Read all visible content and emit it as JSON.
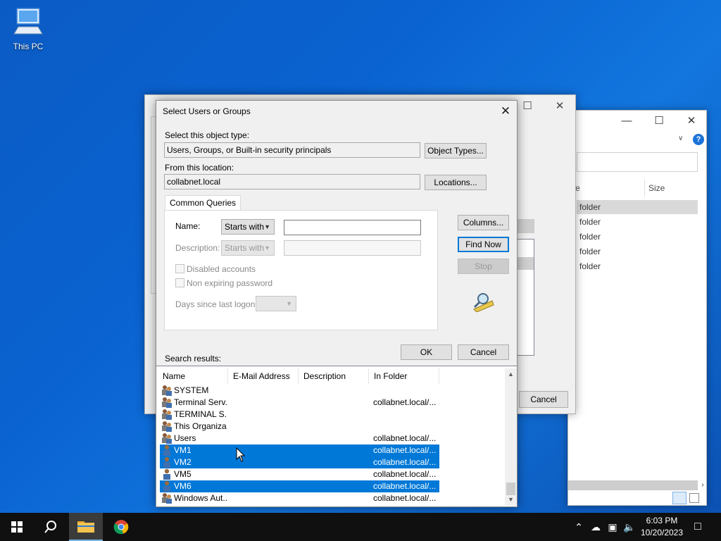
{
  "desktop": {
    "icons": [
      {
        "label": "This PC",
        "icon": "this-pc-icon"
      }
    ]
  },
  "explorer": {
    "columns": [
      "e",
      "Size"
    ],
    "rows": [
      "folder",
      "folder",
      "folder",
      "folder",
      "folder"
    ]
  },
  "perm_dialog": {
    "cancel_label": "Cancel"
  },
  "dialog": {
    "title": "Select Users or Groups",
    "object_type_label": "Select this object type:",
    "object_type_value": "Users, Groups, or Built-in security principals",
    "object_types_button": "Object Types...",
    "location_label": "From this location:",
    "location_value": "collabnet.local",
    "locations_button": "Locations...",
    "tab_label": "Common Queries",
    "name_label": "Name:",
    "name_mode": "Starts with",
    "description_label": "Description:",
    "description_mode": "Starts with",
    "disabled_accounts_label": "Disabled accounts",
    "non_expiring_label": "Non expiring password",
    "days_label": "Days since last logon:",
    "columns_button": "Columns...",
    "find_now_button": "Find Now",
    "stop_button": "Stop",
    "ok_button": "OK",
    "cancel_button": "Cancel",
    "search_results_label": "Search results:"
  },
  "results": {
    "columns": [
      "Name",
      "E-Mail Address",
      "Description",
      "In Folder"
    ],
    "rows": [
      {
        "name": "SYSTEM",
        "folder": "",
        "icon": "group-icon",
        "selected": false
      },
      {
        "name": "Terminal Serv...",
        "folder": "collabnet.local/...",
        "icon": "group-icon",
        "selected": false
      },
      {
        "name": "TERMINAL S...",
        "folder": "",
        "icon": "group-icon",
        "selected": false
      },
      {
        "name": "This Organiza...",
        "folder": "",
        "icon": "group-icon",
        "selected": false
      },
      {
        "name": "Users",
        "folder": "collabnet.local/...",
        "icon": "group-icon",
        "selected": false
      },
      {
        "name": "VM1",
        "folder": "collabnet.local/...",
        "icon": "user-icon",
        "selected": true
      },
      {
        "name": "VM2",
        "folder": "collabnet.local/...",
        "icon": "user-icon",
        "selected": true
      },
      {
        "name": "VM5",
        "folder": "collabnet.local/...",
        "icon": "user-icon",
        "selected": false
      },
      {
        "name": "VM6",
        "folder": "collabnet.local/...",
        "icon": "user-icon",
        "selected": true
      },
      {
        "name": "Windows Aut...",
        "folder": "collabnet.local/...",
        "icon": "group-icon",
        "selected": false
      }
    ]
  },
  "taskbar": {
    "time": "6:03 PM",
    "date": "10/20/2023"
  },
  "colors": {
    "selection": "#0078d7",
    "taskbar": "#101010",
    "desktop": "#0a63d1"
  }
}
